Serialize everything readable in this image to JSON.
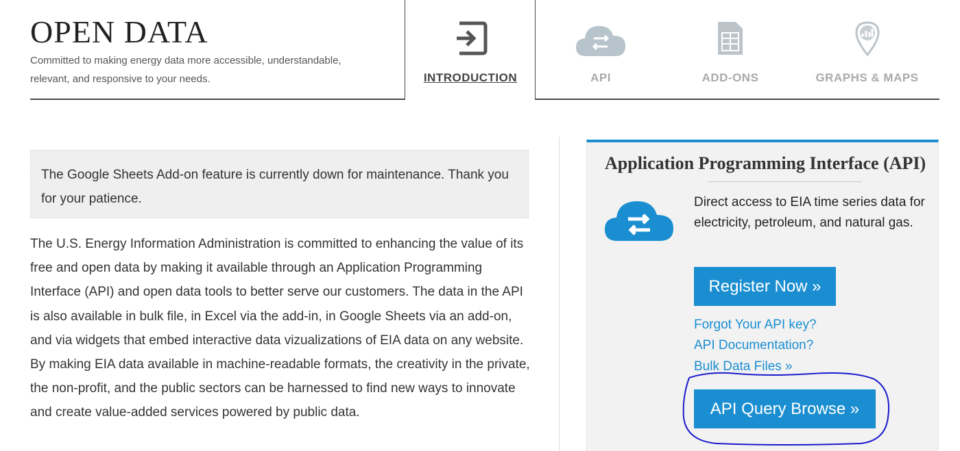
{
  "header": {
    "title": "OPEN DATA",
    "tagline": "Committed to making energy data more accessible, understandable, relevant, and responsive to your needs."
  },
  "tabs": [
    {
      "label": "INTRODUCTION",
      "icon": "sign-in-icon",
      "active": true
    },
    {
      "label": "API",
      "icon": "cloud-transfer-icon",
      "active": false
    },
    {
      "label": "ADD-ONS",
      "icon": "spreadsheet-icon",
      "active": false
    },
    {
      "label": "GRAPHS & MAPS",
      "icon": "map-pin-chart-icon",
      "active": false
    }
  ],
  "notice": {
    "text": "The Google Sheets Add-on feature is currently down for maintenance. Thank you for your patience."
  },
  "intro": {
    "text": "The U.S. Energy Information Administration is committed to enhancing the value of its free and open data by making it available through an Application Programming Interface (API) and open data tools to better serve our customers. The data in the API is also available in bulk file, in Excel via the add-in, in Google Sheets via an add-on, and via widgets that embed interactive data vizualizations of EIA data on any website. By making EIA data available in machine-readable formats, the creativity in the private, the non-profit, and the public sectors can be harnessed to find new ways to innovate and create value-added services powered by public data."
  },
  "api_panel": {
    "title": "Application Programming Interface (API)",
    "description": "Direct access to EIA time series data for electricity, petroleum, and natural gas.",
    "register_label": "Register Now »",
    "links": {
      "forgot": "Forgot Your API key?",
      "docs": "API Documentation?",
      "bulk": "Bulk Data Files »"
    },
    "query_label": "API Query Browse »",
    "icon": "cloud-transfer-icon"
  },
  "colors": {
    "accent": "#1a8ed1",
    "annotation": "#1a1acc",
    "tab_inactive": "#aaaaaa",
    "tab_active": "#444444"
  }
}
